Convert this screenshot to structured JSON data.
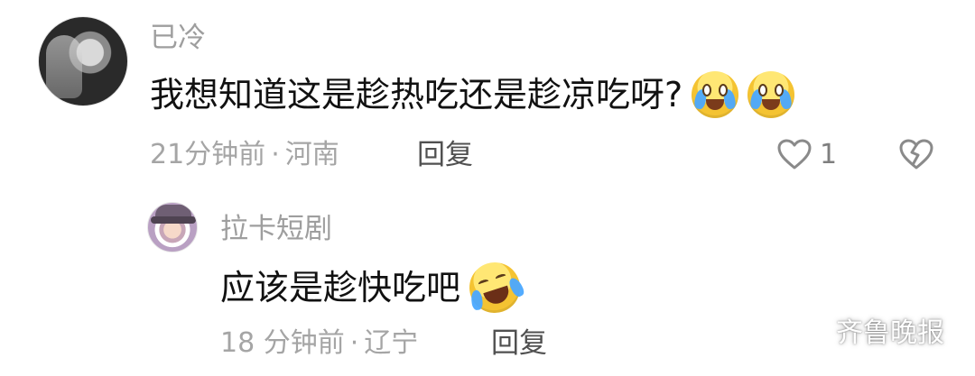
{
  "comments": {
    "main": {
      "author": "已冷",
      "text": "我想知道这是趁热吃还是趁凉吃呀?",
      "meta_time": "21分钟前",
      "meta_separator": "·",
      "meta_location": "河南",
      "reply_label": "回复",
      "like_count": "1",
      "emojis": [
        "crying-laughing-icon",
        "crying-laughing-icon"
      ]
    },
    "reply": {
      "author": "拉卡短剧",
      "text": "应该是趁快吃吧",
      "meta_time": "18 分钟前",
      "meta_separator": "·",
      "meta_location": "辽宁",
      "reply_label": "回复",
      "emojis": [
        "rolling-laughing-icon"
      ]
    }
  },
  "watermark": {
    "text": "齐鲁晚报",
    "icon": "wechat-icon"
  },
  "icons": {
    "like": "heart-outline-icon",
    "dislike": "broken-heart-icon"
  },
  "colors": {
    "background": "#ffffff",
    "name": "#9e9e9e",
    "body_text": "#111111",
    "meta": "#a5a5a5",
    "reply_button": "#505050"
  }
}
